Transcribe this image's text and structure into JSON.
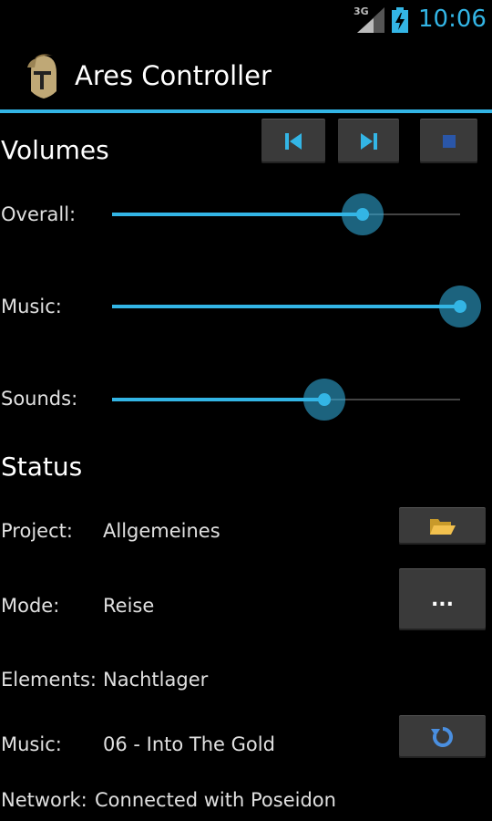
{
  "status_bar": {
    "network": "3G",
    "time": "10:06"
  },
  "app": {
    "title": "Ares Controller"
  },
  "volumes": {
    "title": "Volumes",
    "sliders": [
      {
        "label": "Overall:",
        "value": 0.72
      },
      {
        "label": "Music:",
        "value": 1.0
      },
      {
        "label": "Sounds:",
        "value": 0.61
      }
    ]
  },
  "status": {
    "title": "Status",
    "project": {
      "label": "Project:",
      "value": "Allgemeines"
    },
    "mode": {
      "label": "Mode:",
      "value": "Reise",
      "button": "..."
    },
    "elements": {
      "label": "Elements:",
      "value": "Nachtlager"
    },
    "music": {
      "label": "Music:",
      "value": "06 - Into The Gold"
    },
    "network": {
      "label": "Network:",
      "value": "Connected with Poseidon"
    }
  },
  "colors": {
    "accent": "#33b5e5",
    "button": "#3a3a3a",
    "background": "#000000"
  }
}
